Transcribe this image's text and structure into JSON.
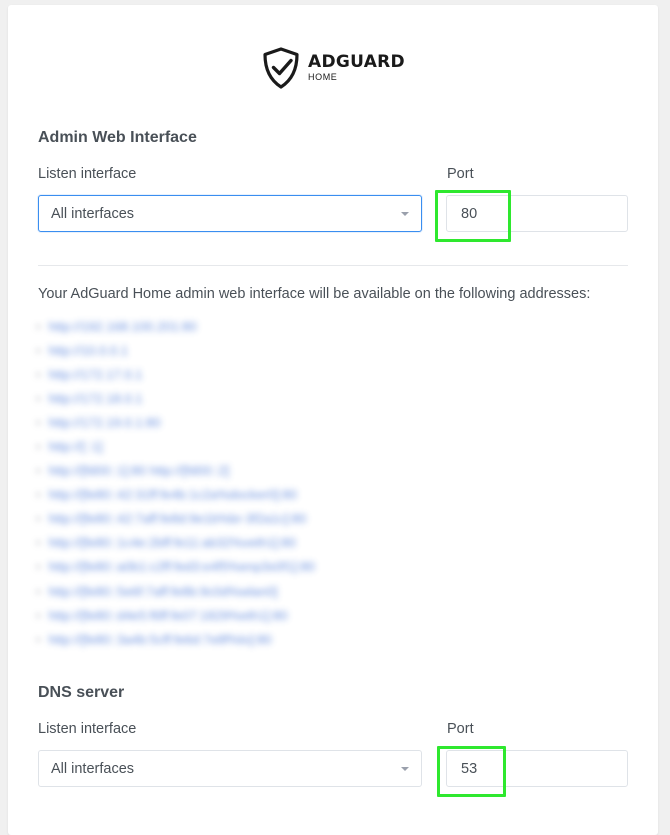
{
  "logo": {
    "name": "ADGUARD",
    "sub": "HOME",
    "icon": "adguard-shield-icon"
  },
  "admin": {
    "title": "Admin Web Interface",
    "listen_label": "Listen interface",
    "listen_value": "All interfaces",
    "port_label": "Port",
    "port_value": "80"
  },
  "info": {
    "text": "Your AdGuard Home admin web interface will be available on the following addresses:",
    "addresses": [
      "http://192.168.100.201:80",
      "http://10.0.0.1",
      "http://172.17.0.1",
      "http://172.18.0.1",
      "http://172.19.0.1:80",
      "http://[::1]",
      "http://[fd00::1]:80 http://[fd00::2]",
      "http://[fe80::42:31ff:fe4b:1c2a%docker0]:80",
      "http://[fe80::42:7aff:fe8d:9e1b%br-3f2a1c]:80",
      "http://[fe80::1c4e:2bff:fe11:ab32%veth1]:80",
      "http://[fe80::a0b1:c2ff:fed3:e4f5%enp3s0f1]:80",
      "http://[fe80::5e6f:7aff:fe8b:9c0d%wlan0]",
      "http://[fe80::d4e5:f6ff:fe07:1829%eth1]:80",
      "http://[fe80::3a4b:5cff:fe6d:7e8f%lo]:80"
    ]
  },
  "dns": {
    "title": "DNS server",
    "listen_label": "Listen interface",
    "listen_value": "All interfaces",
    "port_label": "Port",
    "port_value": "53"
  },
  "colors": {
    "highlight": "#2ee82e",
    "focus_border": "#3a8ef0",
    "text": "#495057"
  }
}
